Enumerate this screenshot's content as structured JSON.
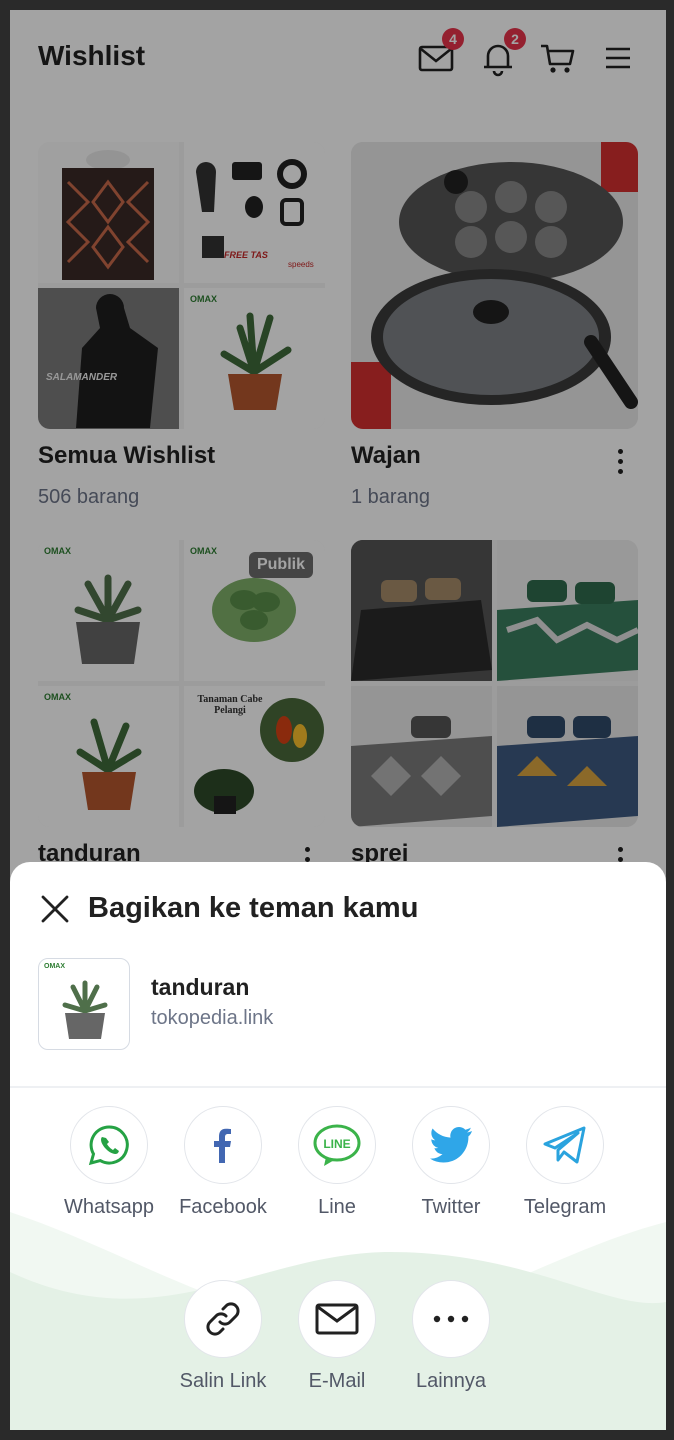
{
  "header": {
    "title": "Wishlist",
    "icons": {
      "mail": {
        "name": "mail-icon",
        "badge": "4"
      },
      "bell": {
        "name": "bell-icon",
        "badge": "2"
      },
      "cart": {
        "name": "cart-icon"
      },
      "menu": {
        "name": "hamburger-menu-icon"
      }
    }
  },
  "wishlists": [
    {
      "name": "Semua Wishlist",
      "count": "506 barang"
    },
    {
      "name": "Wajan",
      "count": "1 barang"
    },
    {
      "name": "tanduran",
      "count": "",
      "badge": "Publik"
    },
    {
      "name": "sprei",
      "count": ""
    }
  ],
  "product_image_text": {
    "free_tas": "FREE TAS",
    "speeds": "speeds",
    "salamander": "SALAMANDER",
    "omax": "OMAX",
    "cabe_title": "Tanaman Cabe Pelangi"
  },
  "share_sheet": {
    "title": "Bagikan ke teman kamu",
    "product": {
      "name": "tanduran",
      "link": "tokopedia.link"
    },
    "apps": [
      {
        "label": "Whatsapp",
        "icon": "whatsapp-icon"
      },
      {
        "label": "Facebook",
        "icon": "facebook-icon"
      },
      {
        "label": "Line",
        "icon": "line-icon"
      },
      {
        "label": "Twitter",
        "icon": "twitter-icon"
      },
      {
        "label": "Telegram",
        "icon": "telegram-icon"
      }
    ],
    "actions": [
      {
        "label": "Salin Link",
        "icon": "link-icon"
      },
      {
        "label": "E-Mail",
        "icon": "mail-icon"
      },
      {
        "label": "Lainnya",
        "icon": "more-icon"
      }
    ],
    "line_icon_text": "LINE"
  },
  "colors": {
    "badge": "#e8334a",
    "text": "#212121",
    "muted": "#6d7588",
    "whatsapp": "#25a244",
    "facebook": "#1877f2",
    "line": "#06c755",
    "twitter": "#1d9bf0",
    "telegram": "#2aa3de",
    "wave": "#dff0e3"
  }
}
